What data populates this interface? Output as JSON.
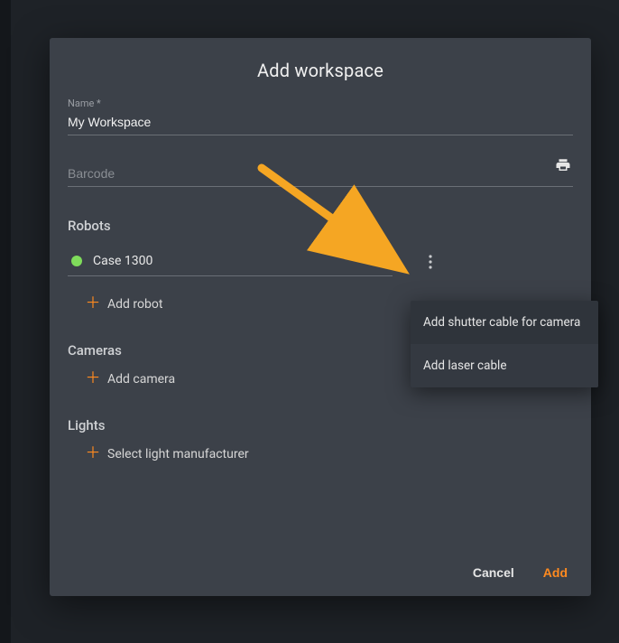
{
  "dialog": {
    "title": "Add workspace",
    "name_label": "Name *",
    "name_value": "My Workspace",
    "barcode_placeholder": "Barcode",
    "barcode_value": ""
  },
  "robots": {
    "section_title": "Robots",
    "selected": "Case 1300",
    "add_label": "Add robot"
  },
  "cameras": {
    "section_title": "Cameras",
    "add_label": "Add camera"
  },
  "lights": {
    "section_title": "Lights",
    "add_label": "Select light manufacturer"
  },
  "actions": {
    "cancel": "Cancel",
    "add": "Add"
  },
  "context_menu": {
    "item1": "Add shutter cable for camera",
    "item2": "Add laser cable"
  }
}
